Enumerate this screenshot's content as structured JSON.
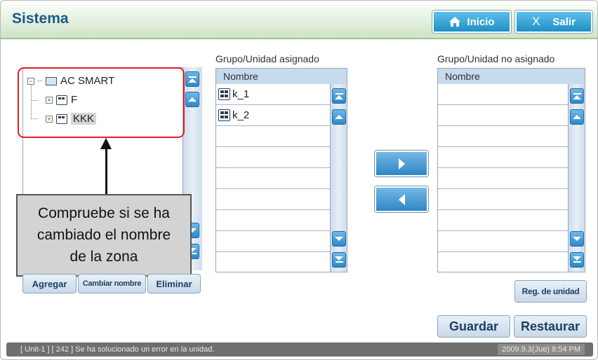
{
  "header": {
    "title": "Sistema",
    "home_label": "Inicio",
    "exit_symbol": "X",
    "exit_label": "Salir"
  },
  "tree": {
    "root": "AC SMART",
    "children": [
      "F",
      "KKK"
    ],
    "selected": "KKK"
  },
  "callout": {
    "line1": "Compruebe si se ha",
    "line2": "cambiado el nombre",
    "line3": "de la zona"
  },
  "tree_buttons": {
    "add": "Agregar",
    "rename": "Cambiar nombre",
    "delete": "Eliminar"
  },
  "assigned": {
    "title": "Grupo/Unidad asignado",
    "column": "Nombre",
    "items": [
      "k_1",
      "k_2"
    ]
  },
  "unassigned": {
    "title": "Grupo/Unidad no asignado",
    "column": "Nombre",
    "items": []
  },
  "actions": {
    "reg_unit": "Reg. de unidad",
    "save": "Guardar",
    "restore": "Restaurar"
  },
  "status": {
    "message": "[ Unit-1 ] [ 242 ] Se ha solucionado un error en la unidad.",
    "datetime": "2009.9.3(Jue)  8:54 PM"
  },
  "colors": {
    "title": "#1a5a88",
    "accent_button": "#2f86c5",
    "highlight_border": "#e02020"
  }
}
